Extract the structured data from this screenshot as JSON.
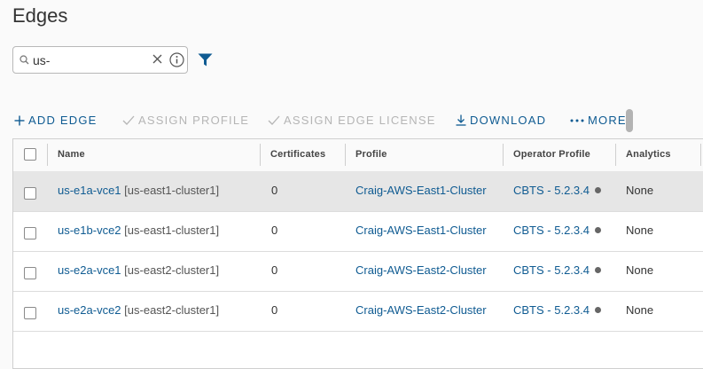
{
  "page": {
    "title": "Edges"
  },
  "search": {
    "value": "us-"
  },
  "toolbar": {
    "add_edge": "ADD EDGE",
    "assign_profile": "ASSIGN PROFILE",
    "assign_edge_license": "ASSIGN EDGE LICENSE",
    "download": "DOWNLOAD",
    "more": "MORE"
  },
  "table": {
    "columns": [
      "Name",
      "Certificates",
      "Profile",
      "Operator Profile",
      "Analytics"
    ],
    "rows": [
      {
        "name": "us-e1a-vce1",
        "cluster": "[us-east1-cluster1]",
        "certificates": "0",
        "profile": "Craig-AWS-East1-Cluster",
        "operator_profile": "CBTS - 5.2.3.4",
        "analytics": "None",
        "selected": true
      },
      {
        "name": "us-e1b-vce2",
        "cluster": "[us-east1-cluster1]",
        "certificates": "0",
        "profile": "Craig-AWS-East1-Cluster",
        "operator_profile": "CBTS - 5.2.3.4",
        "analytics": "None",
        "selected": false
      },
      {
        "name": "us-e2a-vce1",
        "cluster": "[us-east2-cluster1]",
        "certificates": "0",
        "profile": "Craig-AWS-East2-Cluster",
        "operator_profile": "CBTS - 5.2.3.4",
        "analytics": "None",
        "selected": false
      },
      {
        "name": "us-e2a-vce2",
        "cluster": "[us-east2-cluster1]",
        "certificates": "0",
        "profile": "Craig-AWS-East2-Cluster",
        "operator_profile": "CBTS - 5.2.3.4",
        "analytics": "None",
        "selected": false
      }
    ]
  },
  "colors": {
    "link": "#0f5b92",
    "disabled": "#b5b5b5",
    "selected_row": "#e6e6e6",
    "status_dot": "#666666"
  },
  "icons": {
    "search": "search-icon",
    "clear": "close-icon",
    "info": "info-icon",
    "filter": "filter-icon",
    "add": "plus-icon",
    "assign": "check-icon",
    "download": "download-icon",
    "more": "ellipsis-icon"
  }
}
